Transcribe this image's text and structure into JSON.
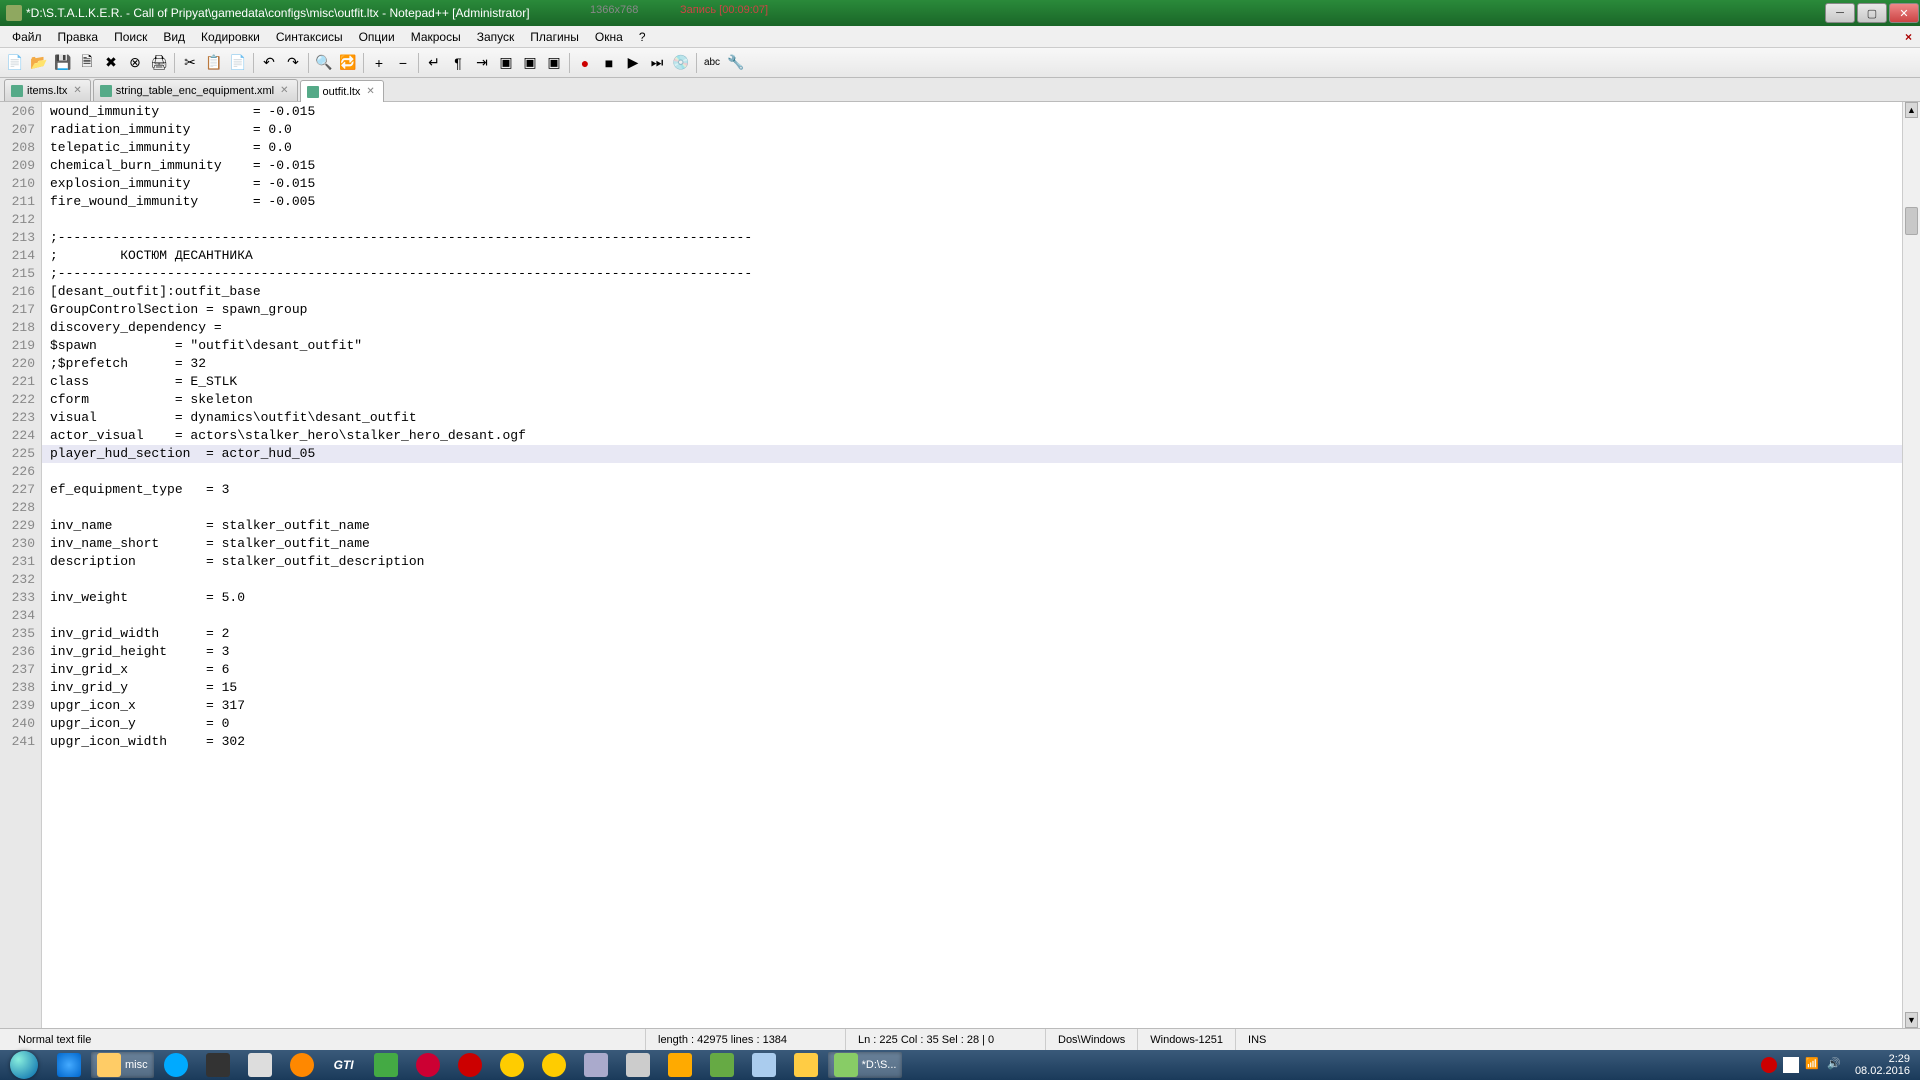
{
  "titlebar": {
    "path": "*D:\\S.T.A.L.K.E.R. - Call of Pripyat\\gamedata\\configs\\misc\\outfit.ltx - Notepad++ [Administrator]",
    "overlay_dim": "1366x768",
    "overlay_rec": "Запись [00:09:07]"
  },
  "menus": [
    "Файл",
    "Правка",
    "Поиск",
    "Вид",
    "Кодировки",
    "Синтаксисы",
    "Опции",
    "Макросы",
    "Запуск",
    "Плагины",
    "Окна",
    "?"
  ],
  "tabs": [
    {
      "label": "items.ltx",
      "active": false
    },
    {
      "label": "string_table_enc_equipment.xml",
      "active": false
    },
    {
      "label": "outfit.ltx",
      "active": true
    }
  ],
  "lines": [
    {
      "n": 206,
      "t": "wound_immunity            = -0.015"
    },
    {
      "n": 207,
      "t": "radiation_immunity        = 0.0"
    },
    {
      "n": 208,
      "t": "telepatic_immunity        = 0.0"
    },
    {
      "n": 209,
      "t": "chemical_burn_immunity    = -0.015"
    },
    {
      "n": 210,
      "t": "explosion_immunity        = -0.015"
    },
    {
      "n": 211,
      "t": "fire_wound_immunity       = -0.005"
    },
    {
      "n": 212,
      "t": ""
    },
    {
      "n": 213,
      "t": ";-----------------------------------------------------------------------------------------"
    },
    {
      "n": 214,
      "t": ";        КОСТЮМ ДЕСАНТНИКА"
    },
    {
      "n": 215,
      "t": ";-----------------------------------------------------------------------------------------"
    },
    {
      "n": 216,
      "t": "[desant_outfit]:outfit_base"
    },
    {
      "n": 217,
      "t": "GroupControlSection = spawn_group"
    },
    {
      "n": 218,
      "t": "discovery_dependency ="
    },
    {
      "n": 219,
      "t": "$spawn          = \"outfit\\desant_outfit\""
    },
    {
      "n": 220,
      "t": ";$prefetch      = 32"
    },
    {
      "n": 221,
      "t": "class           = E_STLK"
    },
    {
      "n": 222,
      "t": "cform           = skeleton"
    },
    {
      "n": 223,
      "t": "visual          = dynamics\\outfit\\desant_outfit"
    },
    {
      "n": 224,
      "t": "actor_visual    = actors\\stalker_hero\\stalker_hero_desant.ogf"
    },
    {
      "n": 225,
      "t": "player_hud_section  = actor_hud_05",
      "hl": true
    },
    {
      "n": 226,
      "t": ""
    },
    {
      "n": 227,
      "t": "ef_equipment_type   = 3"
    },
    {
      "n": 228,
      "t": ""
    },
    {
      "n": 229,
      "t": "inv_name            = stalker_outfit_name"
    },
    {
      "n": 230,
      "t": "inv_name_short      = stalker_outfit_name"
    },
    {
      "n": 231,
      "t": "description         = stalker_outfit_description"
    },
    {
      "n": 232,
      "t": ""
    },
    {
      "n": 233,
      "t": "inv_weight          = 5.0"
    },
    {
      "n": 234,
      "t": ""
    },
    {
      "n": 235,
      "t": "inv_grid_width      = 2"
    },
    {
      "n": 236,
      "t": "inv_grid_height     = 3"
    },
    {
      "n": 237,
      "t": "inv_grid_x          = 6"
    },
    {
      "n": 238,
      "t": "inv_grid_y          = 15"
    },
    {
      "n": 239,
      "t": "upgr_icon_x         = 317"
    },
    {
      "n": 240,
      "t": "upgr_icon_y         = 0"
    },
    {
      "n": 241,
      "t": "upgr_icon_width     = 302"
    }
  ],
  "status": {
    "filetype": "Normal text file",
    "length": "length : 42975    lines : 1384",
    "pos": "Ln : 225    Col : 35    Sel : 28 | 0",
    "eol": "Dos\\Windows",
    "enc": "Windows-1251",
    "ins": "INS"
  },
  "taskbar": {
    "folder_label": "misc",
    "npp_label": "*D:\\S...",
    "time": "2:29",
    "date": "08.02.2016"
  },
  "icons": {
    "new": "📄",
    "open": "📂",
    "save": "💾",
    "saveall": "🗎",
    "close": "✖",
    "closeall": "⊗",
    "print": "🖨",
    "cut": "✂",
    "copy": "📋",
    "paste": "📄",
    "undo": "↶",
    "redo": "↷",
    "find": "🔍",
    "replace": "🔁",
    "zoom_in": "+",
    "zoom_out": "−",
    "wrap": "↵",
    "all_chars": "¶",
    "indent": "⇥",
    "fold": "▣",
    "rec": "●",
    "stop": "■",
    "play": "▶",
    "play2": "⏭",
    "save_macro": "💿",
    "spell": "abc",
    "extra": "🔧"
  }
}
